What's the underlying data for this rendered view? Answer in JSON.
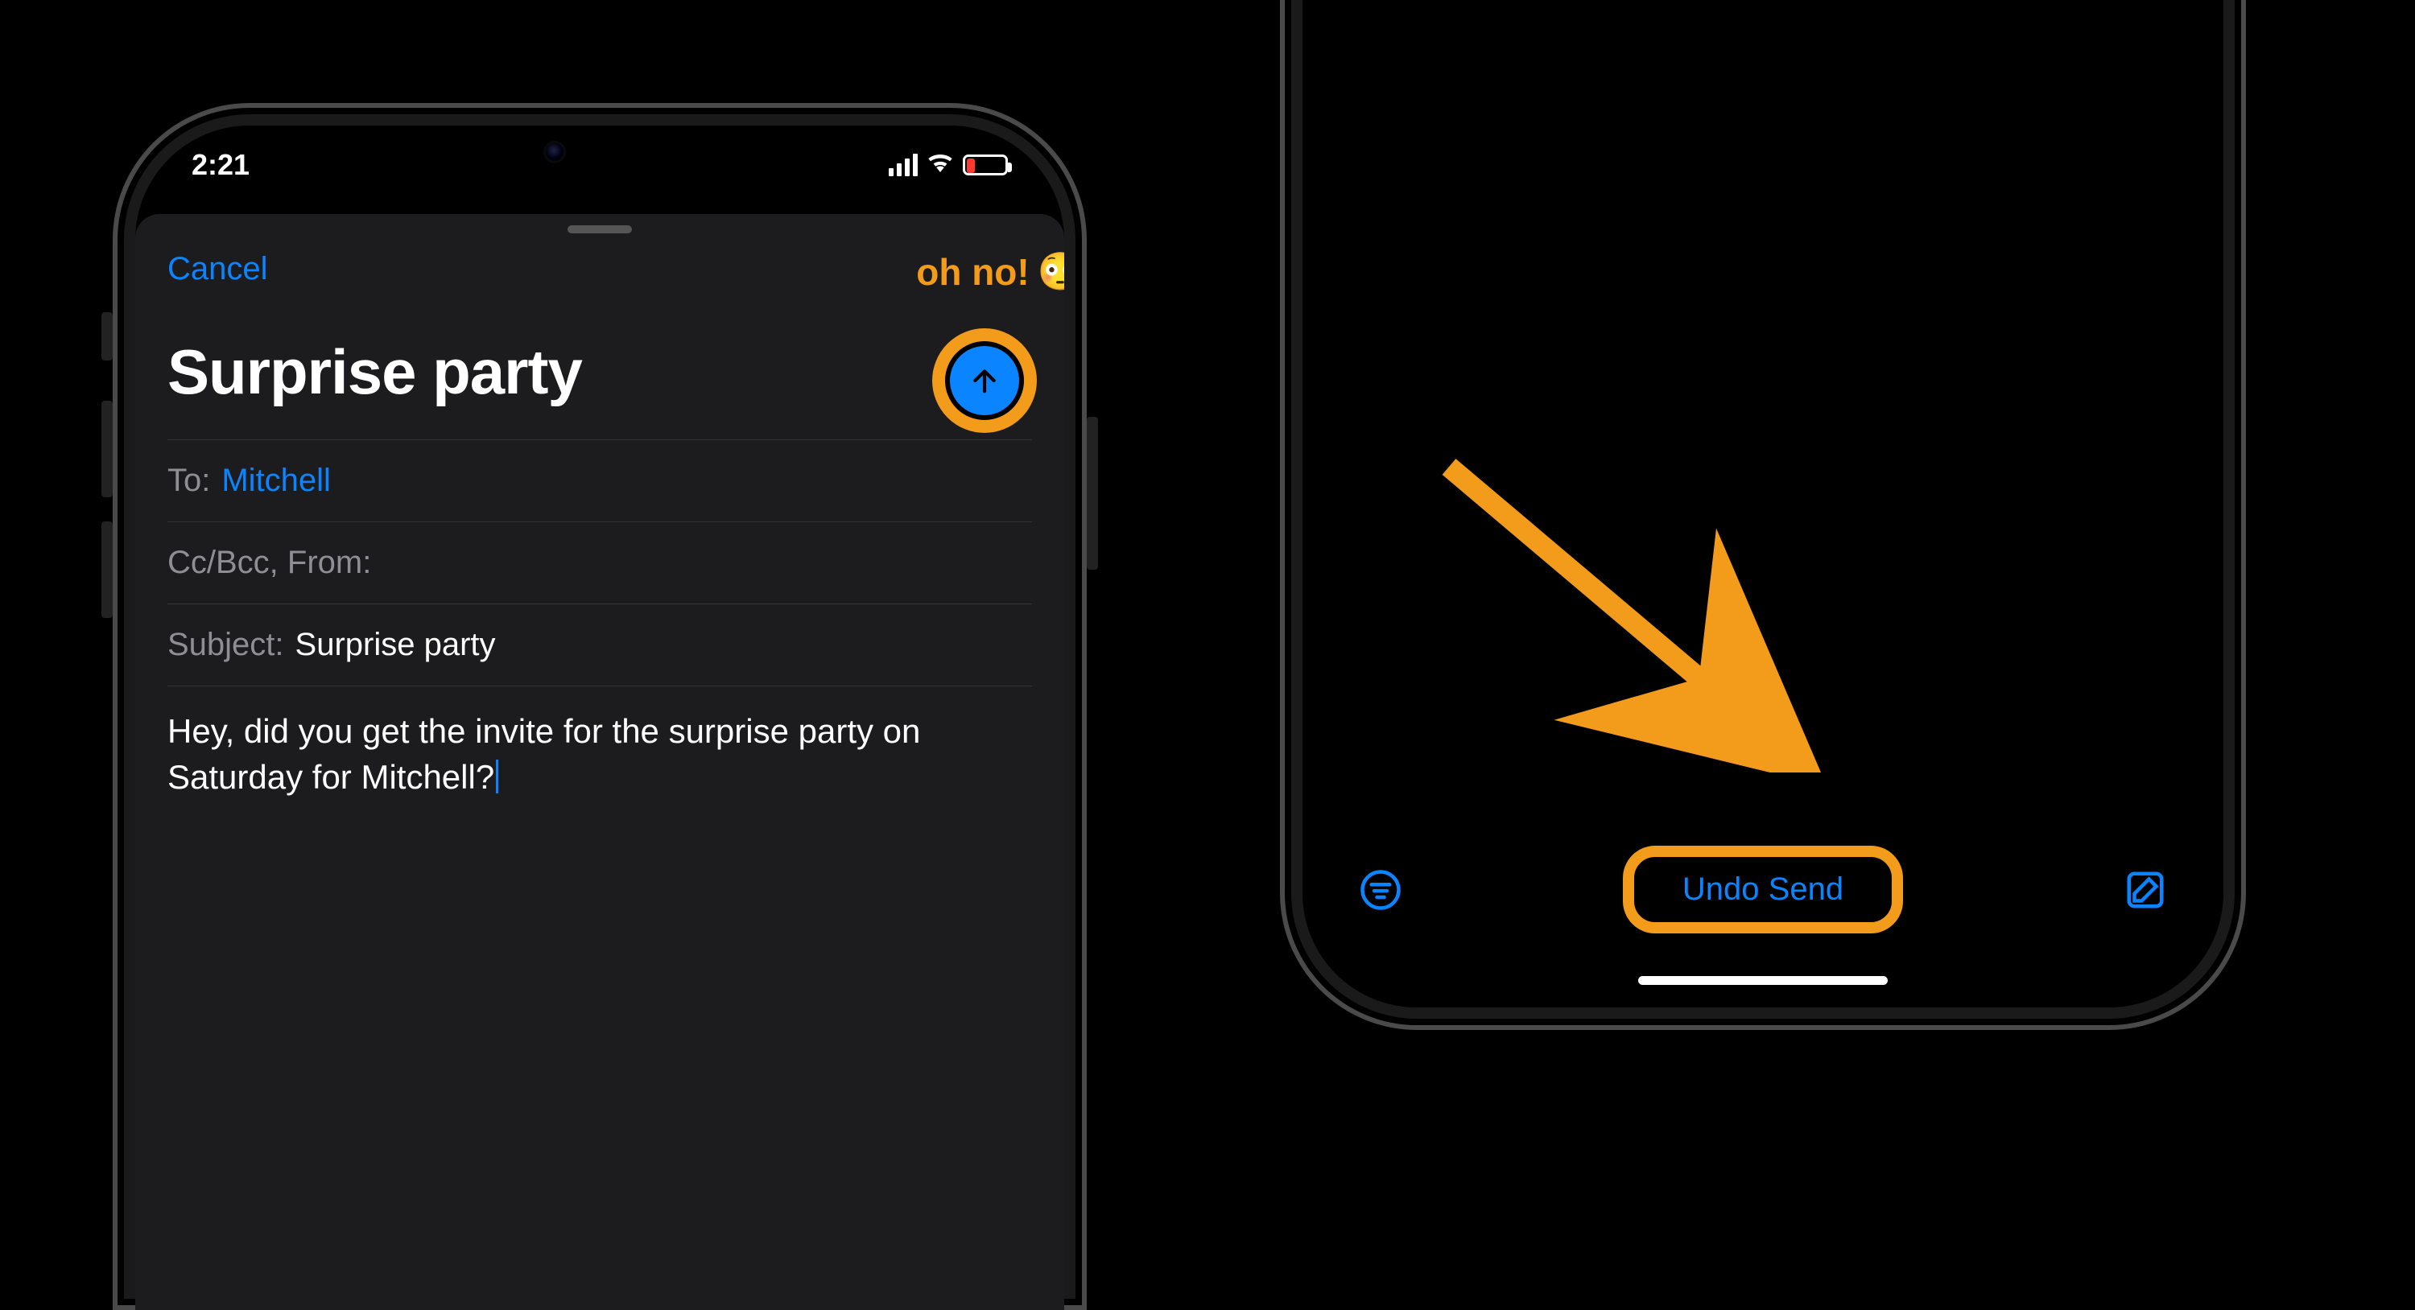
{
  "annotations": {
    "callout_text": "oh no!",
    "callout_emoji": "😳"
  },
  "left": {
    "status": {
      "time": "2:21"
    },
    "compose": {
      "cancel": "Cancel",
      "title": "Surprise party",
      "to_label": "To:",
      "to_value": "Mitchell",
      "cc_label": "Cc/Bcc, From:",
      "subject_label": "Subject:",
      "subject_value": "Surprise party",
      "body": "Hey, did you get the invite for the surprise party on Saturday for Mitchell?"
    }
  },
  "right": {
    "undo_label": "Undo Send"
  }
}
